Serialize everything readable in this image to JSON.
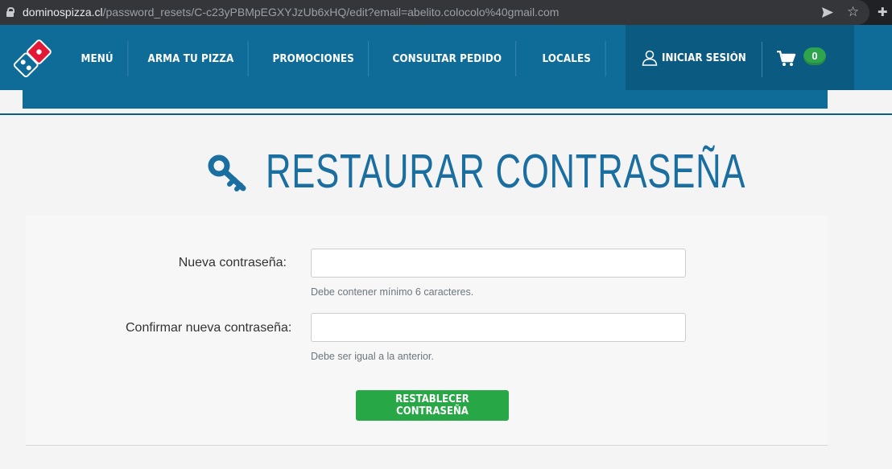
{
  "browser": {
    "url_host": "dominospizza.cl",
    "url_path": "/password_resets/C-c23yPBMpEGXYJzUb6xHQ/edit?email=abelito.colocolo%40gmail.com"
  },
  "nav": {
    "items": [
      {
        "label": "MENÚ"
      },
      {
        "label": "ARMA TU PIZZA"
      },
      {
        "label": "PROMOCIONES"
      },
      {
        "label": "CONSULTAR PEDIDO"
      },
      {
        "label": "LOCALES"
      }
    ],
    "login_label": "INICIAR SESIÓN",
    "cart_count": "0"
  },
  "page": {
    "title": "RESTAURAR CONTRASEÑA"
  },
  "form": {
    "new_password": {
      "label": "Nueva contraseña:",
      "value": "",
      "help": "Debe contener mínimo 6 caracteres."
    },
    "confirm_password": {
      "label": "Confirmar nueva contraseña:",
      "value": "",
      "help": "Debe ser igual a la anterior."
    },
    "submit_label": "RESTABLECER CONTRASEÑA"
  },
  "colors": {
    "brand_blue": "#0f6c99",
    "header_dark": "#0a5a82",
    "title_blue": "#1b6fa0",
    "accent_green": "#27a745",
    "logo_red": "#e31837"
  }
}
